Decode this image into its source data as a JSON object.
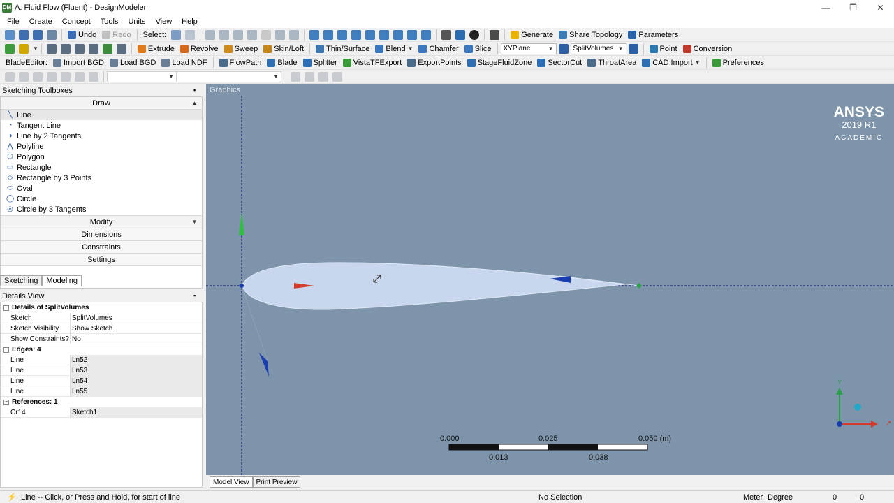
{
  "window": {
    "title": "A: Fluid Flow (Fluent) - DesignModeler",
    "app_icon": "DM",
    "minimize": "—",
    "restore": "❐",
    "close": "✕"
  },
  "menu": [
    "File",
    "Create",
    "Concept",
    "Tools",
    "Units",
    "View",
    "Help"
  ],
  "toolbar1": {
    "undo": "Undo",
    "redo": "Redo",
    "select": "Select:",
    "generate": "Generate",
    "share_topology": "Share Topology",
    "parameters": "Parameters"
  },
  "toolbar2": {
    "extrude": "Extrude",
    "revolve": "Revolve",
    "sweep": "Sweep",
    "skin_loft": "Skin/Loft",
    "thin_surface": "Thin/Surface",
    "blend": "Blend",
    "chamfer": "Chamfer",
    "slice": "Slice",
    "plane": "XYPlane",
    "body_op": "SplitVolumes",
    "point": "Point",
    "conversion": "Conversion"
  },
  "toolbar3": {
    "blade_editor": "BladeEditor:",
    "import_bgd": "Import BGD",
    "load_bgd": "Load BGD",
    "load_ndf": "Load NDF",
    "flowpath": "FlowPath",
    "blade": "Blade",
    "splitter": "Splitter",
    "vista_tf_export": "VistaTFExport",
    "export_points": "ExportPoints",
    "stage_fluid_zone": "StageFluidZone",
    "sector_cut": "SectorCut",
    "throat_area": "ThroatArea",
    "cad_import": "CAD Import",
    "preferences": "Preferences"
  },
  "sketching": {
    "title": "Sketching Toolboxes",
    "draw": "Draw",
    "draw_items": [
      "Line",
      "Tangent Line",
      "Line by 2 Tangents",
      "Polyline",
      "Polygon",
      "Rectangle",
      "Rectangle by 3 Points",
      "Oval",
      "Circle",
      "Circle by 3 Tangents"
    ],
    "modify": "Modify",
    "dimensions": "Dimensions",
    "constraints": "Constraints",
    "settings": "Settings",
    "tab_sketching": "Sketching",
    "tab_modeling": "Modeling"
  },
  "details": {
    "title": "Details View",
    "heading": "Details of SplitVolumes",
    "rows": [
      {
        "k": "Sketch",
        "v": "SplitVolumes"
      },
      {
        "k": "Sketch Visibility",
        "v": "Show Sketch"
      },
      {
        "k": "Show Constraints?",
        "v": "No"
      }
    ],
    "edges_heading": "Edges: 4",
    "edges": [
      {
        "k": "Line",
        "v": "Ln52"
      },
      {
        "k": "Line",
        "v": "Ln53"
      },
      {
        "k": "Line",
        "v": "Ln54"
      },
      {
        "k": "Line",
        "v": "Ln55"
      }
    ],
    "refs_heading": "References: 1",
    "refs": [
      {
        "k": "Cr14",
        "v": "Sketch1"
      }
    ]
  },
  "graphics": {
    "title": "Graphics",
    "brand": "ANSYS",
    "version": "2019 R1",
    "edition": "ACADEMIC",
    "scale_top": [
      "0.000",
      "0.025",
      "0.050 (m)"
    ],
    "scale_bottom": [
      "0.013",
      "0.038"
    ],
    "triad_y": "Y"
  },
  "bottom_tabs": [
    "Model View",
    "Print Preview"
  ],
  "status": {
    "hint": "Line -- Click, or Press and Hold, for start of line",
    "selection": "No Selection",
    "length_unit": "Meter",
    "angle_unit": "Degree",
    "val1": "0",
    "val2": "0"
  },
  "colors": {
    "graphics_bg": "#7d94aa",
    "airfoil_fill": "#c9d7ee",
    "axis": "#0a1a66"
  }
}
